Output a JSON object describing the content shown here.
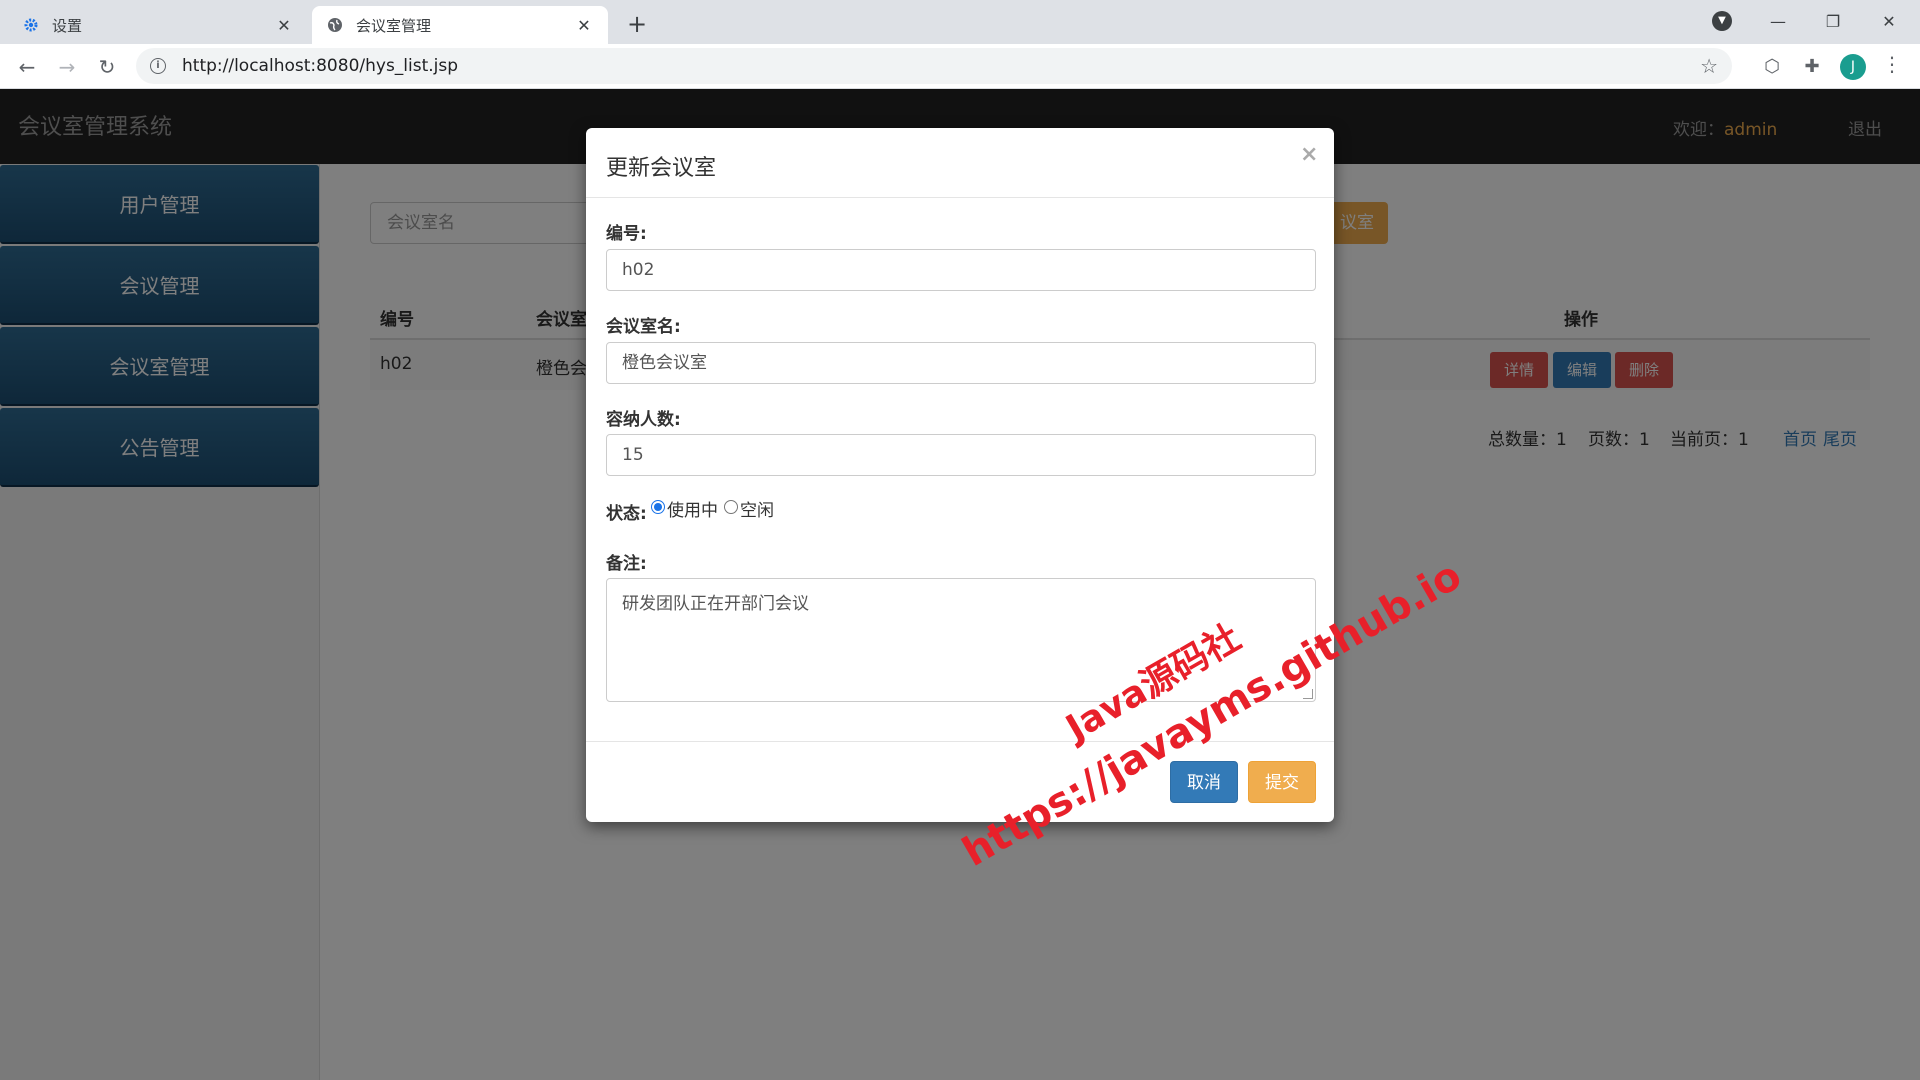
{
  "browser": {
    "tabs": [
      {
        "label": "设置",
        "icon": "gear-icon"
      },
      {
        "label": "会议室管理",
        "icon": "globe-icon"
      }
    ],
    "url": "http://localhost:8080/hys_list.jsp",
    "profile_initial": "J"
  },
  "app": {
    "brand": "会议室管理系统",
    "welcome_label": "欢迎：",
    "username": "admin",
    "logout": "退出",
    "sidebar": {
      "items": [
        {
          "label": "用户管理"
        },
        {
          "label": "会议管理"
        },
        {
          "label": "会议室管理"
        },
        {
          "label": "公告管理"
        }
      ]
    },
    "search_placeholder": "会议室名",
    "add_button_partial": "议室",
    "table": {
      "headers": [
        "编号",
        "会议室",
        "操作"
      ],
      "rows": [
        {
          "id": "h02",
          "name_partial": "橙色会"
        }
      ],
      "actions": {
        "detail": "详情",
        "edit": "编辑",
        "delete": "删除"
      }
    },
    "pager": {
      "total_label": "总数量：",
      "total": "1",
      "pages_label": "页数：",
      "pages": "1",
      "current_label": "当前页：",
      "current": "1",
      "first": "首页",
      "last": "尾页"
    }
  },
  "modal": {
    "title": "更新会议室",
    "close_glyph": "×",
    "fields": {
      "id_label": "编号:",
      "id_value": "h02",
      "name_label": "会议室名:",
      "name_value": "橙色会议室",
      "capacity_label": "容纳人数:",
      "capacity_value": "15",
      "status_label": "状态:",
      "status_options": [
        "使用中",
        "空闲"
      ],
      "status_selected": "使用中",
      "note_label": "备注:",
      "note_value": "研发团队正在开部门会议"
    },
    "cancel": "取消",
    "submit": "提交"
  },
  "watermark": {
    "line1": "Java源码社",
    "line2": "https://javayms.github.io"
  },
  "colors": {
    "navbar": "#222222",
    "sidebar_item": "#2f6c94",
    "primary": "#337ab7",
    "warning": "#f0ad4e",
    "danger": "#d9534f",
    "watermark": "#e8202a"
  }
}
